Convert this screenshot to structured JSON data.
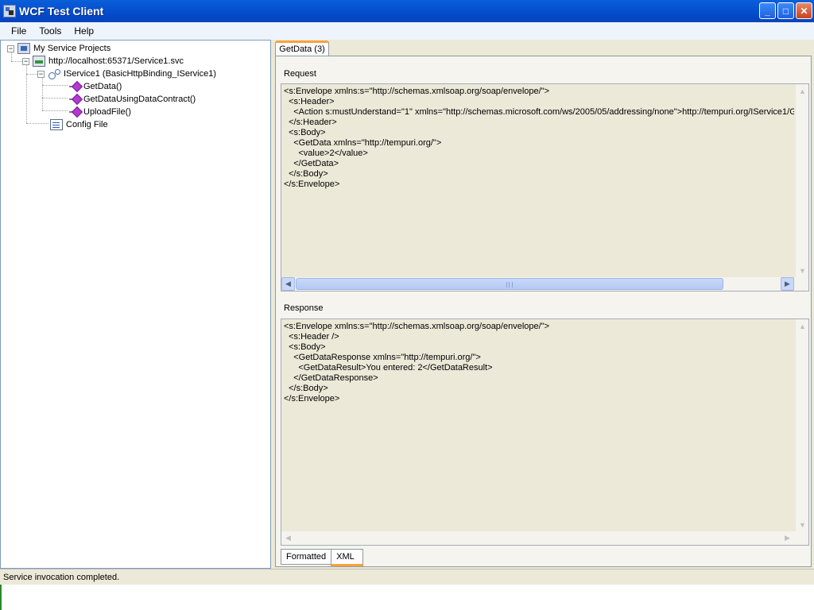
{
  "window": {
    "title": "WCF Test Client",
    "buttons": {
      "minimize": "_",
      "maximize": "□",
      "close": "✕"
    }
  },
  "menu": {
    "items": [
      {
        "label": "File"
      },
      {
        "label": "Tools"
      },
      {
        "label": "Help"
      }
    ]
  },
  "tree": {
    "root": {
      "label": "My Service Projects",
      "expander": "−"
    },
    "service": {
      "label": "http://localhost:65371/Service1.svc",
      "expander": "−"
    },
    "contract": {
      "label": "IService1 (BasicHttpBinding_IService1)",
      "expander": "−"
    },
    "methods": [
      {
        "label": "GetData()"
      },
      {
        "label": "GetDataUsingDataContract()"
      },
      {
        "label": "UploadFile()"
      }
    ],
    "config": {
      "label": "Config File"
    }
  },
  "document_tab": {
    "label": "GetData (3)"
  },
  "request": {
    "label": "Request",
    "xml": "<s:Envelope xmlns:s=\"http://schemas.xmlsoap.org/soap/envelope/\">\n  <s:Header>\n    <Action s:mustUnderstand=\"1\" xmlns=\"http://schemas.microsoft.com/ws/2005/05/addressing/none\">http://tempuri.org/IService1/G\n  </s:Header>\n  <s:Body>\n    <GetData xmlns=\"http://tempuri.org/\">\n      <value>2</value>\n    </GetData>\n  </s:Body>\n</s:Envelope>"
  },
  "response": {
    "label": "Response",
    "xml": "<s:Envelope xmlns:s=\"http://schemas.xmlsoap.org/soap/envelope/\">\n  <s:Header />\n  <s:Body>\n    <GetDataResponse xmlns=\"http://tempuri.org/\">\n      <GetDataResult>You entered: 2</GetDataResult>\n    </GetDataResponse>\n  </s:Body>\n</s:Envelope>"
  },
  "view_tabs": [
    {
      "label": "Formatted",
      "active": false
    },
    {
      "label": "XML",
      "active": true
    }
  ],
  "status": {
    "text": "Service invocation completed."
  },
  "scroll_glyphs": {
    "up": "▲",
    "down": "▼",
    "left": "◀",
    "right": "▶"
  }
}
